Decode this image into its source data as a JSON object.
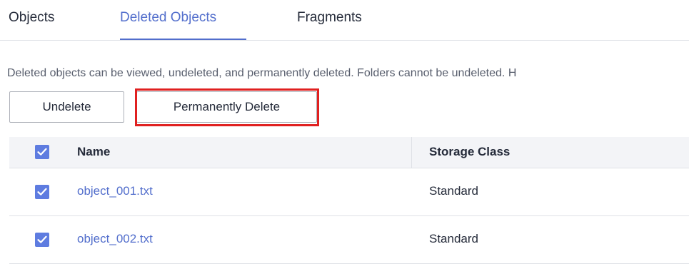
{
  "tabs": [
    {
      "label": "Objects",
      "active": false
    },
    {
      "label": "Deleted Objects",
      "active": true
    },
    {
      "label": "Fragments",
      "active": false
    }
  ],
  "description": "Deleted objects can be viewed, undeleted, and permanently deleted. Folders cannot be undeleted. H",
  "toolbar": {
    "undelete_label": "Undelete",
    "permanently_delete_label": "Permanently Delete"
  },
  "table": {
    "columns": [
      "Name",
      "Storage Class"
    ],
    "header_checked": true,
    "rows": [
      {
        "name": "object_001.txt",
        "storage_class": "Standard",
        "checked": true
      },
      {
        "name": "object_002.txt",
        "storage_class": "Standard",
        "checked": true
      }
    ]
  },
  "colors": {
    "accent": "#526ecc",
    "checkbox": "#5e7ce0",
    "highlight": "#e02020"
  },
  "icons": {
    "checkbox": "check-icon"
  }
}
